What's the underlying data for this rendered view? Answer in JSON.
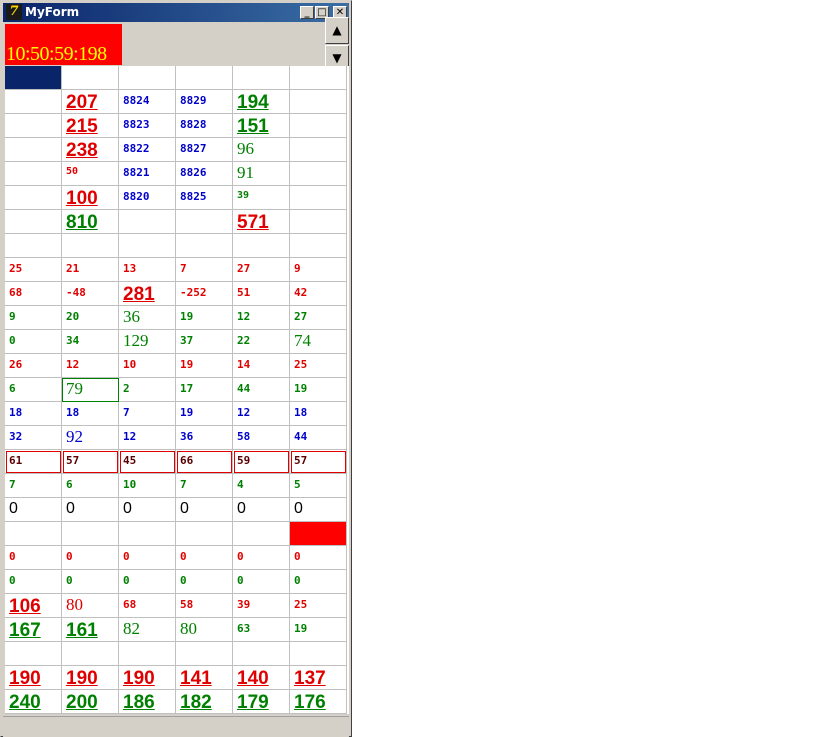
{
  "window": {
    "title": "MyForm",
    "app_icon_glyph": "7",
    "min_glyph": "_",
    "max_glyph": "□",
    "close_glyph": "✕"
  },
  "clock": {
    "time": "10:50:59:198"
  },
  "scroll": {
    "up_glyph": "▲",
    "down_glyph": "▼"
  },
  "colors": {
    "red": "#e00000",
    "green": "#008000",
    "blue": "#0000cc",
    "clock_bg": "#ff0000",
    "clock_fg": "#ffff00",
    "title_bar": "#0a246a"
  },
  "grid": {
    "rows": [
      [
        {
          "t": "",
          "c": "",
          "s": "s",
          "f": "navy"
        },
        {
          "t": "",
          "c": "",
          "s": "s"
        },
        {
          "t": "",
          "c": "",
          "s": "s"
        },
        {
          "t": "",
          "c": "",
          "s": "s"
        },
        {
          "t": "",
          "c": "",
          "s": "s"
        },
        {
          "t": "",
          "c": "",
          "s": "s"
        }
      ],
      [
        {
          "t": "",
          "c": "",
          "s": "s"
        },
        {
          "t": "207",
          "c": "red",
          "s": "l"
        },
        {
          "t": "8824",
          "c": "blu",
          "s": "s"
        },
        {
          "t": "8829",
          "c": "blu",
          "s": "s"
        },
        {
          "t": "194",
          "c": "grn",
          "s": "l"
        },
        {
          "t": "",
          "c": "",
          "s": "s"
        }
      ],
      [
        {
          "t": "",
          "c": "",
          "s": "s"
        },
        {
          "t": "215",
          "c": "red",
          "s": "l"
        },
        {
          "t": "8823",
          "c": "blu",
          "s": "s"
        },
        {
          "t": "8828",
          "c": "blu",
          "s": "s"
        },
        {
          "t": "151",
          "c": "grn",
          "s": "l"
        },
        {
          "t": "",
          "c": "",
          "s": "s"
        }
      ],
      [
        {
          "t": "",
          "c": "",
          "s": "s"
        },
        {
          "t": "238",
          "c": "red",
          "s": "l"
        },
        {
          "t": "8822",
          "c": "blu",
          "s": "s"
        },
        {
          "t": "8827",
          "c": "blu",
          "s": "s"
        },
        {
          "t": "96",
          "c": "grn",
          "s": "m"
        },
        {
          "t": "",
          "c": "",
          "s": "s"
        }
      ],
      [
        {
          "t": "",
          "c": "",
          "s": "s"
        },
        {
          "t": "50",
          "c": "red",
          "s": "x"
        },
        {
          "t": "8821",
          "c": "blu",
          "s": "s"
        },
        {
          "t": "8826",
          "c": "blu",
          "s": "s"
        },
        {
          "t": "91",
          "c": "grn",
          "s": "m"
        },
        {
          "t": "",
          "c": "",
          "s": "s"
        }
      ],
      [
        {
          "t": "",
          "c": "",
          "s": "s"
        },
        {
          "t": "100",
          "c": "red",
          "s": "l"
        },
        {
          "t": "8820",
          "c": "blu",
          "s": "s"
        },
        {
          "t": "8825",
          "c": "blu",
          "s": "s"
        },
        {
          "t": "39",
          "c": "grn",
          "s": "x"
        },
        {
          "t": "",
          "c": "",
          "s": "s"
        }
      ],
      [
        {
          "t": "",
          "c": "",
          "s": "s"
        },
        {
          "t": "810",
          "c": "grn",
          "s": "l"
        },
        {
          "t": "",
          "c": "",
          "s": "s"
        },
        {
          "t": "",
          "c": "",
          "s": "s"
        },
        {
          "t": "571",
          "c": "red",
          "s": "l"
        },
        {
          "t": "",
          "c": "",
          "s": "s"
        }
      ],
      [
        {
          "t": "",
          "c": "",
          "s": "s"
        },
        {
          "t": "",
          "c": "",
          "s": "s"
        },
        {
          "t": "",
          "c": "",
          "s": "s"
        },
        {
          "t": "",
          "c": "",
          "s": "s"
        },
        {
          "t": "",
          "c": "",
          "s": "s"
        },
        {
          "t": "",
          "c": "",
          "s": "s"
        }
      ],
      [
        {
          "t": "25",
          "c": "red",
          "s": "s"
        },
        {
          "t": "21",
          "c": "red",
          "s": "s"
        },
        {
          "t": "13",
          "c": "red",
          "s": "s"
        },
        {
          "t": "7",
          "c": "red",
          "s": "s"
        },
        {
          "t": "27",
          "c": "red",
          "s": "s"
        },
        {
          "t": "9",
          "c": "red",
          "s": "s"
        }
      ],
      [
        {
          "t": "68",
          "c": "red",
          "s": "s"
        },
        {
          "t": "-48",
          "c": "red",
          "s": "s"
        },
        {
          "t": "281",
          "c": "red",
          "s": "l"
        },
        {
          "t": "-252",
          "c": "red",
          "s": "s"
        },
        {
          "t": "51",
          "c": "red",
          "s": "s"
        },
        {
          "t": "42",
          "c": "red",
          "s": "s"
        }
      ],
      [
        {
          "t": "9",
          "c": "grn",
          "s": "s"
        },
        {
          "t": "20",
          "c": "grn",
          "s": "s"
        },
        {
          "t": "36",
          "c": "grn",
          "s": "m"
        },
        {
          "t": "19",
          "c": "grn",
          "s": "s"
        },
        {
          "t": "12",
          "c": "grn",
          "s": "s"
        },
        {
          "t": "27",
          "c": "grn",
          "s": "s"
        }
      ],
      [
        {
          "t": "0",
          "c": "grn",
          "s": "s"
        },
        {
          "t": "34",
          "c": "grn",
          "s": "s"
        },
        {
          "t": "129",
          "c": "grn",
          "s": "m"
        },
        {
          "t": "37",
          "c": "grn",
          "s": "s"
        },
        {
          "t": "22",
          "c": "grn",
          "s": "s"
        },
        {
          "t": "74",
          "c": "grn",
          "s": "m"
        }
      ],
      [
        {
          "t": "26",
          "c": "red",
          "s": "s"
        },
        {
          "t": "12",
          "c": "red",
          "s": "s"
        },
        {
          "t": "10",
          "c": "red",
          "s": "s"
        },
        {
          "t": "19",
          "c": "red",
          "s": "s"
        },
        {
          "t": "14",
          "c": "red",
          "s": "s"
        },
        {
          "t": "25",
          "c": "red",
          "s": "s"
        }
      ],
      [
        {
          "t": "6",
          "c": "grn",
          "s": "s"
        },
        {
          "t": "79",
          "c": "grn",
          "s": "m",
          "b": "g"
        },
        {
          "t": "2",
          "c": "grn",
          "s": "s"
        },
        {
          "t": "17",
          "c": "grn",
          "s": "s"
        },
        {
          "t": "44",
          "c": "grn",
          "s": "s"
        },
        {
          "t": "19",
          "c": "grn",
          "s": "s"
        }
      ],
      [
        {
          "t": "18",
          "c": "blu",
          "s": "s"
        },
        {
          "t": "18",
          "c": "blu",
          "s": "s"
        },
        {
          "t": "7",
          "c": "blu",
          "s": "s"
        },
        {
          "t": "19",
          "c": "blu",
          "s": "s"
        },
        {
          "t": "12",
          "c": "blu",
          "s": "s"
        },
        {
          "t": "18",
          "c": "blu",
          "s": "s"
        }
      ],
      [
        {
          "t": "32",
          "c": "blu",
          "s": "s"
        },
        {
          "t": "92",
          "c": "blu",
          "s": "m"
        },
        {
          "t": "12",
          "c": "blu",
          "s": "s"
        },
        {
          "t": "36",
          "c": "blu",
          "s": "s"
        },
        {
          "t": "58",
          "c": "blu",
          "s": "s"
        },
        {
          "t": "44",
          "c": "blu",
          "s": "s"
        }
      ],
      [
        {
          "t": "61",
          "c": "dk",
          "s": "s",
          "b": "r"
        },
        {
          "t": "57",
          "c": "dk",
          "s": "s",
          "b": "r"
        },
        {
          "t": "45",
          "c": "dk",
          "s": "s",
          "b": "r"
        },
        {
          "t": "66",
          "c": "dk",
          "s": "s",
          "b": "r"
        },
        {
          "t": "59",
          "c": "dk",
          "s": "s",
          "b": "r"
        },
        {
          "t": "57",
          "c": "dk",
          "s": "s",
          "b": "r"
        }
      ],
      [
        {
          "t": "7",
          "c": "grn",
          "s": "s"
        },
        {
          "t": "6",
          "c": "grn",
          "s": "s"
        },
        {
          "t": "10",
          "c": "grn",
          "s": "s"
        },
        {
          "t": "7",
          "c": "grn",
          "s": "s"
        },
        {
          "t": "4",
          "c": "grn",
          "s": "s"
        },
        {
          "t": "5",
          "c": "grn",
          "s": "s"
        }
      ],
      [
        {
          "t": "0",
          "c": "blk",
          "s": "z"
        },
        {
          "t": "0",
          "c": "blk",
          "s": "z"
        },
        {
          "t": "0",
          "c": "blk",
          "s": "z"
        },
        {
          "t": "0",
          "c": "blk",
          "s": "z"
        },
        {
          "t": "0",
          "c": "blk",
          "s": "z"
        },
        {
          "t": "0",
          "c": "blk",
          "s": "z"
        }
      ],
      [
        {
          "t": "",
          "c": "",
          "s": "s"
        },
        {
          "t": "",
          "c": "",
          "s": "s"
        },
        {
          "t": "",
          "c": "",
          "s": "s"
        },
        {
          "t": "",
          "c": "",
          "s": "s"
        },
        {
          "t": "",
          "c": "",
          "s": "s"
        },
        {
          "t": "",
          "c": "",
          "s": "s",
          "f": "red"
        }
      ],
      [
        {
          "t": "0",
          "c": "red",
          "s": "s"
        },
        {
          "t": "0",
          "c": "red",
          "s": "s"
        },
        {
          "t": "0",
          "c": "red",
          "s": "s"
        },
        {
          "t": "0",
          "c": "red",
          "s": "s"
        },
        {
          "t": "0",
          "c": "red",
          "s": "s"
        },
        {
          "t": "0",
          "c": "red",
          "s": "s"
        }
      ],
      [
        {
          "t": "0",
          "c": "grn",
          "s": "s"
        },
        {
          "t": "0",
          "c": "grn",
          "s": "s"
        },
        {
          "t": "0",
          "c": "grn",
          "s": "s"
        },
        {
          "t": "0",
          "c": "grn",
          "s": "s"
        },
        {
          "t": "0",
          "c": "grn",
          "s": "s"
        },
        {
          "t": "0",
          "c": "grn",
          "s": "s"
        }
      ],
      [
        {
          "t": "106",
          "c": "red",
          "s": "l"
        },
        {
          "t": "80",
          "c": "red",
          "s": "m"
        },
        {
          "t": "68",
          "c": "red",
          "s": "s"
        },
        {
          "t": "58",
          "c": "red",
          "s": "s"
        },
        {
          "t": "39",
          "c": "red",
          "s": "s"
        },
        {
          "t": "25",
          "c": "red",
          "s": "s"
        }
      ],
      [
        {
          "t": "167",
          "c": "grn",
          "s": "l"
        },
        {
          "t": "161",
          "c": "grn",
          "s": "l"
        },
        {
          "t": "82",
          "c": "grn",
          "s": "m"
        },
        {
          "t": "80",
          "c": "grn",
          "s": "m"
        },
        {
          "t": "63",
          "c": "grn",
          "s": "s"
        },
        {
          "t": "19",
          "c": "grn",
          "s": "s"
        }
      ],
      [
        {
          "t": "",
          "c": "",
          "s": "s"
        },
        {
          "t": "",
          "c": "",
          "s": "s"
        },
        {
          "t": "",
          "c": "",
          "s": "s"
        },
        {
          "t": "",
          "c": "",
          "s": "s"
        },
        {
          "t": "",
          "c": "",
          "s": "s"
        },
        {
          "t": "",
          "c": "",
          "s": "s"
        }
      ],
      [
        {
          "t": "190",
          "c": "red",
          "s": "l"
        },
        {
          "t": "190",
          "c": "red",
          "s": "l"
        },
        {
          "t": "190",
          "c": "red",
          "s": "l"
        },
        {
          "t": "141",
          "c": "red",
          "s": "l"
        },
        {
          "t": "140",
          "c": "red",
          "s": "l"
        },
        {
          "t": "137",
          "c": "red",
          "s": "l"
        }
      ],
      [
        {
          "t": "240",
          "c": "grn",
          "s": "l"
        },
        {
          "t": "200",
          "c": "grn",
          "s": "l"
        },
        {
          "t": "186",
          "c": "grn",
          "s": "l"
        },
        {
          "t": "182",
          "c": "grn",
          "s": "l"
        },
        {
          "t": "179",
          "c": "grn",
          "s": "l"
        },
        {
          "t": "176",
          "c": "grn",
          "s": "l"
        }
      ]
    ]
  }
}
